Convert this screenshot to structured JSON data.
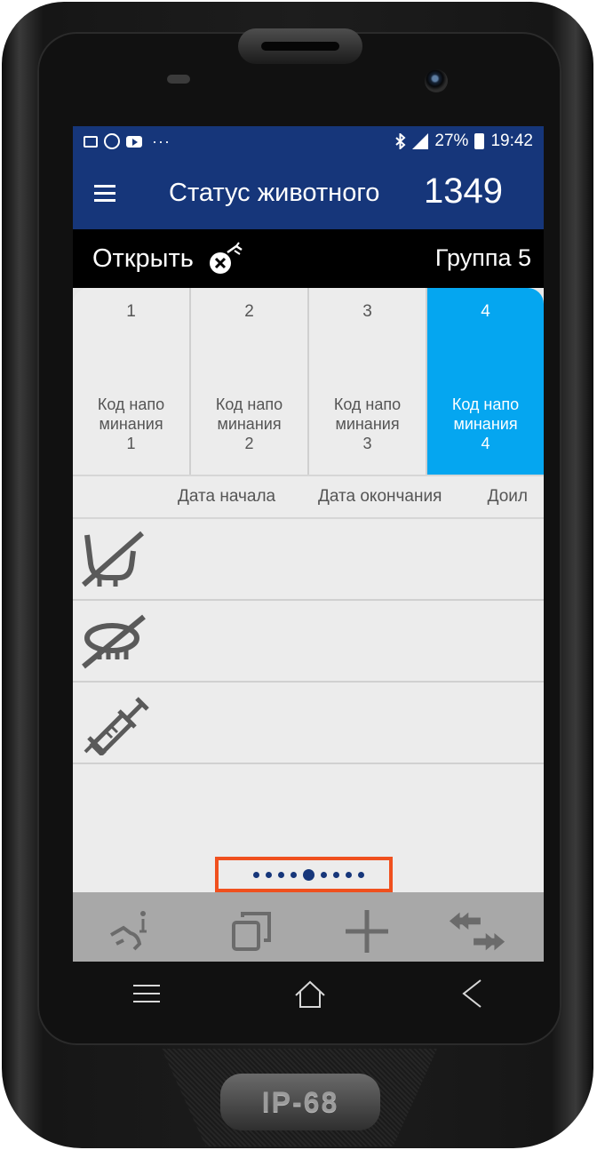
{
  "statusbar": {
    "battery": "27%",
    "time": "19:42",
    "more": "···",
    "icons_left": [
      "gallery-icon",
      "app-circle-icon",
      "youtube-icon"
    ],
    "icons_right": [
      "bluetooth-icon",
      "signal-icon",
      "battery-icon"
    ]
  },
  "appbar": {
    "title": "Статус животного",
    "animal_number": "1349",
    "menu_icon": "hamburger-menu-icon"
  },
  "openbar": {
    "label": "Открыть",
    "icon": "cancel-injection-icon",
    "group": "Группа 5"
  },
  "tabs": [
    {
      "number": "1",
      "line1": "Код напо",
      "line2": "минания",
      "line3": "1",
      "active": false
    },
    {
      "number": "2",
      "line1": "Код напо",
      "line2": "минания",
      "line3": "2",
      "active": false
    },
    {
      "number": "3",
      "line1": "Код напо",
      "line2": "минания",
      "line3": "3",
      "active": false
    },
    {
      "number": "4",
      "line1": "Код напо",
      "line2": "минания",
      "line3": "4",
      "active": true
    }
  ],
  "columns": {
    "start": "Дата начала",
    "end": "Дата окончания",
    "milk": "Доил"
  },
  "rows": [
    {
      "icon": "no-milking-icon"
    },
    {
      "icon": "no-feeding-icon"
    },
    {
      "icon": "syringe-icon"
    }
  ],
  "pager": {
    "total": 9,
    "active_index": 4
  },
  "toolbar": {
    "buttons": [
      "animal-info-icon",
      "copy-icon",
      "add-icon",
      "transfer-icon"
    ]
  },
  "navbar": {
    "buttons": [
      "menu-icon",
      "home-icon",
      "back-icon"
    ]
  },
  "device": {
    "badge": "IP-68"
  },
  "colors": {
    "primary": "#16367a",
    "accent": "#05a6f0",
    "highlight": "#f0501e"
  }
}
